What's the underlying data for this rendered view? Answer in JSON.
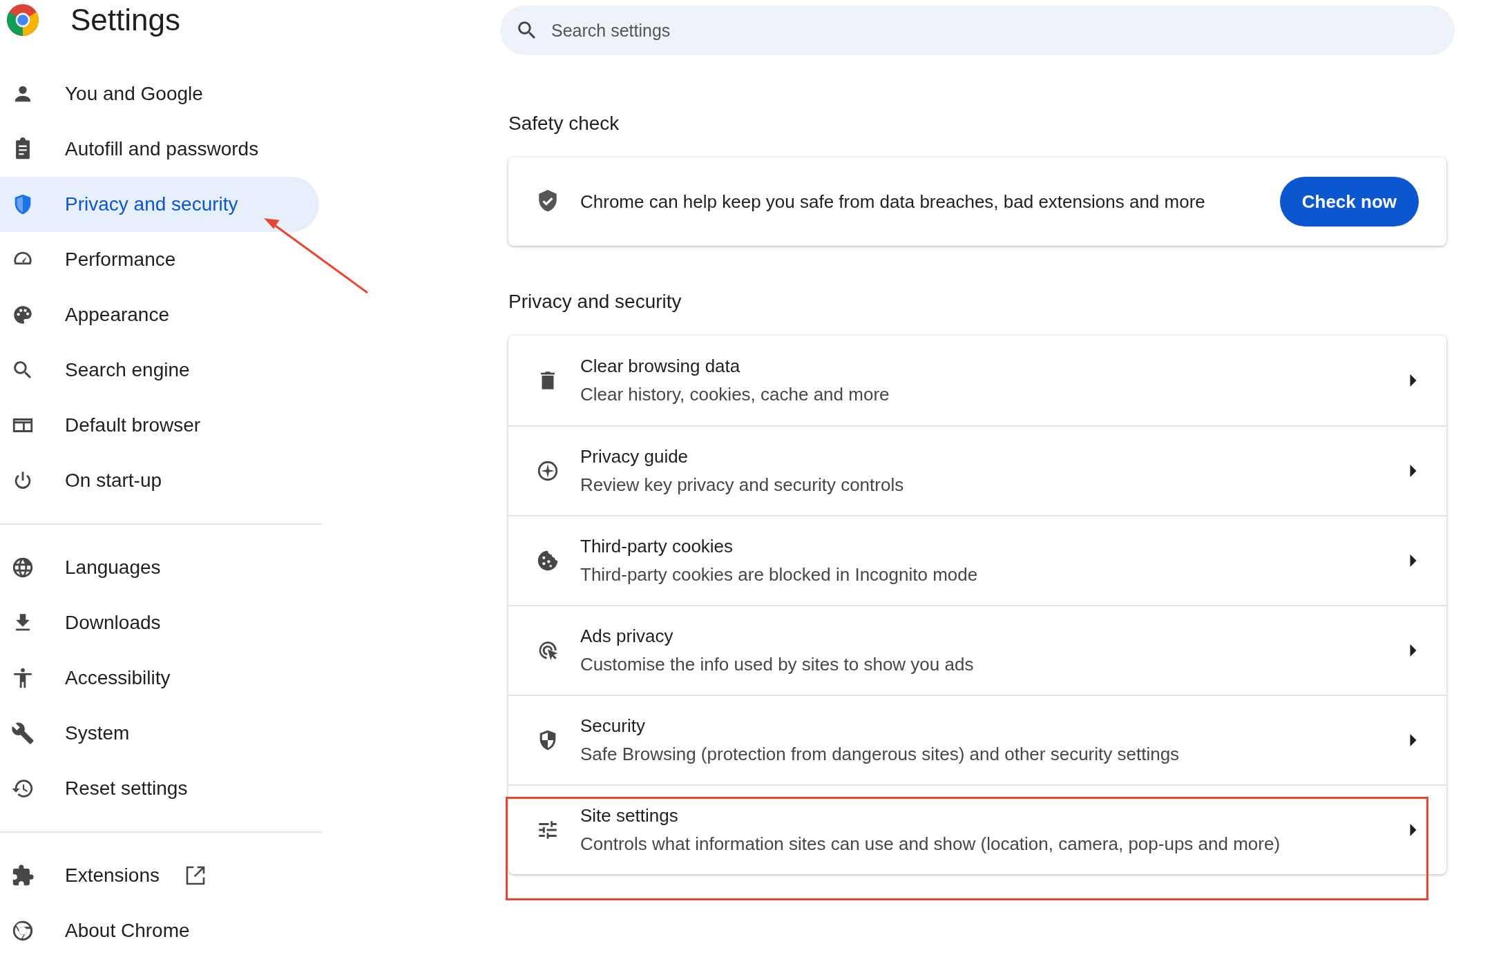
{
  "header": {
    "title": "Settings"
  },
  "search": {
    "placeholder": "Search settings"
  },
  "sidebar": {
    "groups": [
      [
        {
          "label": "You and Google",
          "selected": false
        },
        {
          "label": "Autofill and passwords",
          "selected": false
        },
        {
          "label": "Privacy and security",
          "selected": true
        },
        {
          "label": "Performance",
          "selected": false
        },
        {
          "label": "Appearance",
          "selected": false
        },
        {
          "label": "Search engine",
          "selected": false
        },
        {
          "label": "Default browser",
          "selected": false
        },
        {
          "label": "On start-up",
          "selected": false
        }
      ],
      [
        {
          "label": "Languages",
          "selected": false
        },
        {
          "label": "Downloads",
          "selected": false
        },
        {
          "label": "Accessibility",
          "selected": false
        },
        {
          "label": "System",
          "selected": false
        },
        {
          "label": "Reset settings",
          "selected": false
        }
      ],
      [
        {
          "label": "Extensions",
          "selected": false,
          "external": true
        },
        {
          "label": "About Chrome",
          "selected": false
        }
      ]
    ]
  },
  "safety_check": {
    "heading": "Safety check",
    "text": "Chrome can help keep you safe from data breaches, bad extensions and more",
    "button": "Check now"
  },
  "privacy": {
    "heading": "Privacy and security",
    "rows": [
      {
        "title": "Clear browsing data",
        "subtitle": "Clear history, cookies, cache and more"
      },
      {
        "title": "Privacy guide",
        "subtitle": "Review key privacy and security controls"
      },
      {
        "title": "Third-party cookies",
        "subtitle": "Third-party cookies are blocked in Incognito mode"
      },
      {
        "title": "Ads privacy",
        "subtitle": "Customise the info used by sites to show you ads"
      },
      {
        "title": "Security",
        "subtitle": "Safe Browsing (protection from dangerous sites) and other security settings"
      },
      {
        "title": "Site settings",
        "subtitle": "Controls what information sites can use and show (location, camera, pop-ups and more)",
        "highlighted": true
      }
    ]
  }
}
